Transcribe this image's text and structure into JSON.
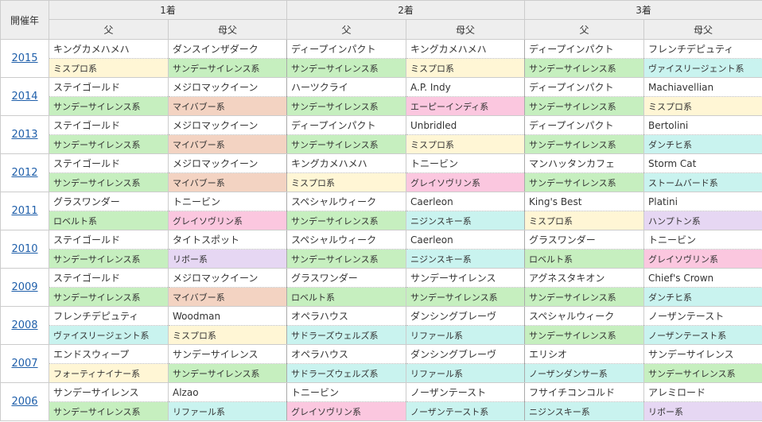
{
  "header": {
    "year": "開催年",
    "ranks": [
      "1着",
      "2着",
      "3着"
    ],
    "sire": "父",
    "bms": "母父"
  },
  "colors": {
    "mr": "#fff6d5",
    "ss": "#c6efbf",
    "mb": "#f3d3c2",
    "ai": "#fbc7df",
    "gr": "#fbc7df",
    "nj": "#c9f3ef",
    "hm": "#fce2f4",
    "rb": "#e6d7f3"
  },
  "rows": [
    {
      "year": "2015",
      "cells": [
        {
          "name": "キングカメハメハ",
          "line": "ミスプロ系",
          "c": "mr"
        },
        {
          "name": "ダンスインザダーク",
          "line": "サンデーサイレンス系",
          "c": "ss"
        },
        {
          "name": "ディープインパクト",
          "line": "サンデーサイレンス系",
          "c": "ss"
        },
        {
          "name": "キングカメハメハ",
          "line": "ミスプロ系",
          "c": "mr"
        },
        {
          "name": "ディープインパクト",
          "line": "サンデーサイレンス系",
          "c": "ss"
        },
        {
          "name": "フレンチデピュティ",
          "line": "ヴァイスリージェント系",
          "c": "nj"
        }
      ]
    },
    {
      "year": "2014",
      "cells": [
        {
          "name": "ステイゴールド",
          "line": "サンデーサイレンス系",
          "c": "ss"
        },
        {
          "name": "メジロマックイーン",
          "line": "マイバブー系",
          "c": "mb"
        },
        {
          "name": "ハーツクライ",
          "line": "サンデーサイレンス系",
          "c": "ss"
        },
        {
          "name": "A.P. Indy",
          "line": "エーピーインディ系",
          "c": "ai"
        },
        {
          "name": "ディープインパクト",
          "line": "サンデーサイレンス系",
          "c": "ss"
        },
        {
          "name": "Machiavellian",
          "line": "ミスプロ系",
          "c": "mr"
        }
      ]
    },
    {
      "year": "2013",
      "cells": [
        {
          "name": "ステイゴールド",
          "line": "サンデーサイレンス系",
          "c": "ss"
        },
        {
          "name": "メジロマックイーン",
          "line": "マイバブー系",
          "c": "mb"
        },
        {
          "name": "ディープインパクト",
          "line": "サンデーサイレンス系",
          "c": "ss"
        },
        {
          "name": "Unbridled",
          "line": "ミスプロ系",
          "c": "mr"
        },
        {
          "name": "ディープインパクト",
          "line": "サンデーサイレンス系",
          "c": "ss"
        },
        {
          "name": "Bertolini",
          "line": "ダンチヒ系",
          "c": "nj"
        }
      ]
    },
    {
      "year": "2012",
      "cells": [
        {
          "name": "ステイゴールド",
          "line": "サンデーサイレンス系",
          "c": "ss"
        },
        {
          "name": "メジロマックイーン",
          "line": "マイバブー系",
          "c": "mb"
        },
        {
          "name": "キングカメハメハ",
          "line": "ミスプロ系",
          "c": "mr"
        },
        {
          "name": "トニービン",
          "line": "グレイソヴリン系",
          "c": "gr"
        },
        {
          "name": "マンハッタンカフェ",
          "line": "サンデーサイレンス系",
          "c": "ss"
        },
        {
          "name": "Storm Cat",
          "line": "ストームバード系",
          "c": "nj"
        }
      ]
    },
    {
      "year": "2011",
      "cells": [
        {
          "name": "グラスワンダー",
          "line": "ロベルト系",
          "c": "ss"
        },
        {
          "name": "トニービン",
          "line": "グレイソヴリン系",
          "c": "gr"
        },
        {
          "name": "スペシャルウィーク",
          "line": "サンデーサイレンス系",
          "c": "ss"
        },
        {
          "name": "Caerleon",
          "line": "ニジンスキー系",
          "c": "nj"
        },
        {
          "name": "King's Best",
          "line": "ミスプロ系",
          "c": "mr"
        },
        {
          "name": "Platini",
          "line": "ハンプトン系",
          "c": "rb"
        }
      ]
    },
    {
      "year": "2010",
      "cells": [
        {
          "name": "ステイゴールド",
          "line": "サンデーサイレンス系",
          "c": "ss"
        },
        {
          "name": "タイトスポット",
          "line": "リボー系",
          "c": "rb"
        },
        {
          "name": "スペシャルウィーク",
          "line": "サンデーサイレンス系",
          "c": "ss"
        },
        {
          "name": "Caerleon",
          "line": "ニジンスキー系",
          "c": "nj"
        },
        {
          "name": "グラスワンダー",
          "line": "ロベルト系",
          "c": "ss"
        },
        {
          "name": "トニービン",
          "line": "グレイソヴリン系",
          "c": "gr"
        }
      ]
    },
    {
      "year": "2009",
      "cells": [
        {
          "name": "ステイゴールド",
          "line": "サンデーサイレンス系",
          "c": "ss"
        },
        {
          "name": "メジロマックイーン",
          "line": "マイバブー系",
          "c": "mb"
        },
        {
          "name": "グラスワンダー",
          "line": "ロベルト系",
          "c": "ss"
        },
        {
          "name": "サンデーサイレンス",
          "line": "サンデーサイレンス系",
          "c": "ss"
        },
        {
          "name": "アグネスタキオン",
          "line": "サンデーサイレンス系",
          "c": "ss"
        },
        {
          "name": "Chief's Crown",
          "line": "ダンチヒ系",
          "c": "nj"
        }
      ]
    },
    {
      "year": "2008",
      "cells": [
        {
          "name": "フレンチデピュティ",
          "line": "ヴァイスリージェント系",
          "c": "nj"
        },
        {
          "name": "Woodman",
          "line": "ミスプロ系",
          "c": "mr"
        },
        {
          "name": "オペラハウス",
          "line": "サドラーズウェルズ系",
          "c": "nj"
        },
        {
          "name": "ダンシングブレーヴ",
          "line": "リファール系",
          "c": "nj"
        },
        {
          "name": "スペシャルウィーク",
          "line": "サンデーサイレンス系",
          "c": "ss"
        },
        {
          "name": "ノーザンテースト",
          "line": "ノーザンテースト系",
          "c": "nj"
        }
      ]
    },
    {
      "year": "2007",
      "cells": [
        {
          "name": "エンドスウィープ",
          "line": "フォーティナイナー系",
          "c": "mr"
        },
        {
          "name": "サンデーサイレンス",
          "line": "サンデーサイレンス系",
          "c": "ss"
        },
        {
          "name": "オペラハウス",
          "line": "サドラーズウェルズ系",
          "c": "nj"
        },
        {
          "name": "ダンシングブレーヴ",
          "line": "リファール系",
          "c": "nj"
        },
        {
          "name": "エリシオ",
          "line": "ノーザンダンサー系",
          "c": "nj"
        },
        {
          "name": "サンデーサイレンス",
          "line": "サンデーサイレンス系",
          "c": "ss"
        }
      ]
    },
    {
      "year": "2006",
      "cells": [
        {
          "name": "サンデーサイレンス",
          "line": "サンデーサイレンス系",
          "c": "ss"
        },
        {
          "name": "Alzao",
          "line": "リファール系",
          "c": "nj"
        },
        {
          "name": "トニービン",
          "line": "グレイソヴリン系",
          "c": "gr"
        },
        {
          "name": "ノーザンテースト",
          "line": "ノーザンテースト系",
          "c": "nj"
        },
        {
          "name": "フサイチコンコルド",
          "line": "ニジンスキー系",
          "c": "nj"
        },
        {
          "name": "アレミロード",
          "line": "リボー系",
          "c": "rb"
        }
      ]
    }
  ]
}
